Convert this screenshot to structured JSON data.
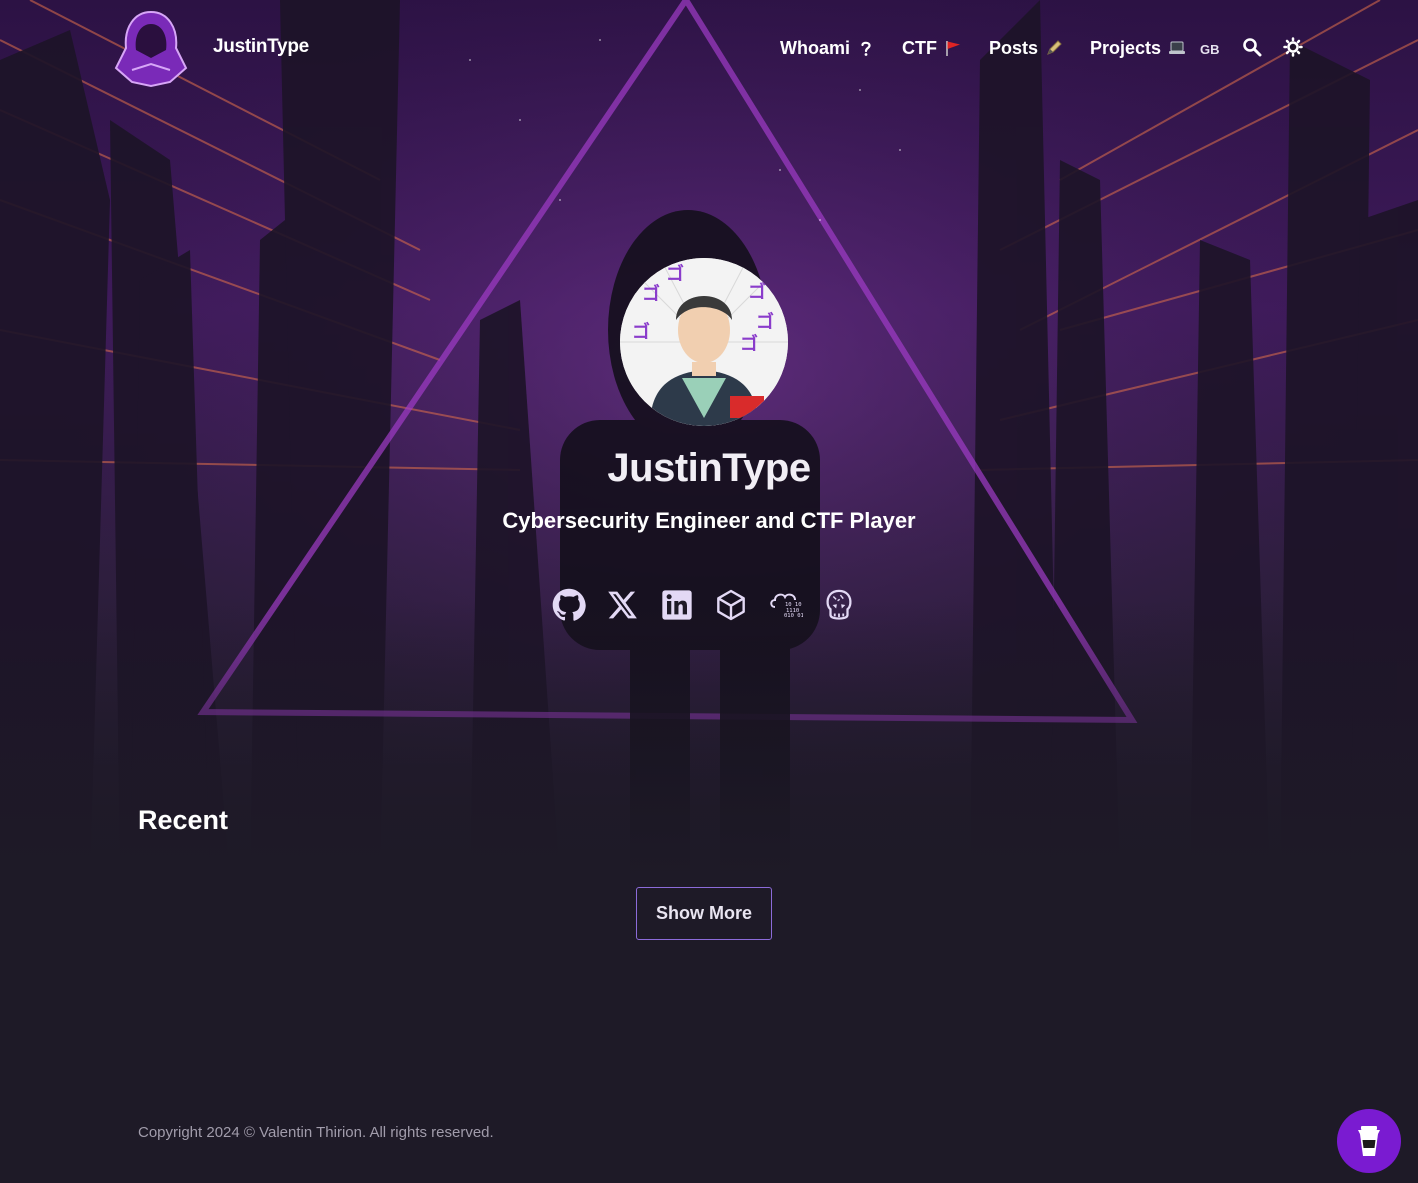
{
  "header": {
    "site_title": "JustinType",
    "nav": [
      {
        "label": "Whoami",
        "icon": "question-mark-emoji"
      },
      {
        "label": "CTF",
        "icon": "red-flag-emoji"
      },
      {
        "label": "Posts",
        "icon": "pen-emoji"
      },
      {
        "label": "Projects",
        "icon": "laptop-emoji"
      }
    ],
    "language": "GB"
  },
  "profile": {
    "name": "JustinType",
    "subtitle": "Cybersecurity Engineer and CTF Player",
    "socials": [
      "github-icon",
      "x-icon",
      "linkedin-icon",
      "hackthebox-icon",
      "tryhackme-icon",
      "rootme-icon"
    ]
  },
  "recent": {
    "heading": "Recent",
    "show_more_label": "Show More"
  },
  "footer": {
    "copyright": "Copyright 2024 © Valentin Thirion. All rights reserved."
  },
  "colors": {
    "background": "#1e1a27",
    "accent": "#7a1bd1",
    "button_border": "#8c6bd9"
  }
}
